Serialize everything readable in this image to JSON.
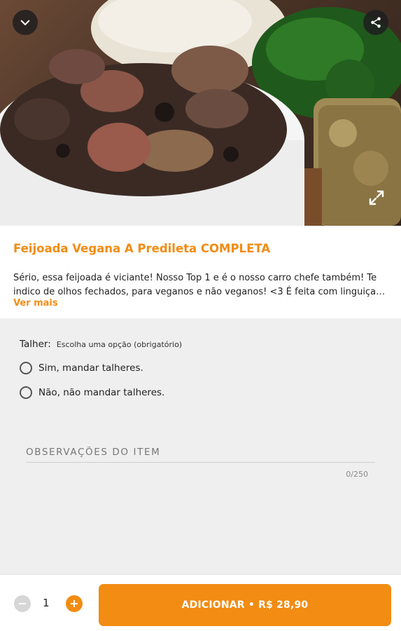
{
  "item": {
    "title": "Feijoada Vegana A Predileta COMPLETA",
    "description": "Sério, essa feijoada é viciante! Nosso Top 1 e é o nosso carro chefe também! Te indico de olhos fechados, para veganos e não veganos! <3 É feita com linguiça do f...",
    "see_more": "Ver mais"
  },
  "hero": {
    "back_icon": "chevron-down-icon",
    "share_icon": "share-icon",
    "expand_icon": "expand-icon"
  },
  "option_group": {
    "title": "Talher:",
    "hint": "Escolha uma opção (obrigatório)",
    "options": [
      {
        "label": "Sim, mandar talheres.",
        "selected": false
      },
      {
        "label": "Não, não mandar talheres.",
        "selected": false
      }
    ]
  },
  "observations": {
    "placeholder": "OBSERVAÇÕES DO ITEM",
    "counter": "0/250"
  },
  "footer": {
    "quantity": "1",
    "add_label": "ADICIONAR • R$ 28,90"
  },
  "colors": {
    "accent": "#f28c13",
    "background": "#efefef"
  }
}
